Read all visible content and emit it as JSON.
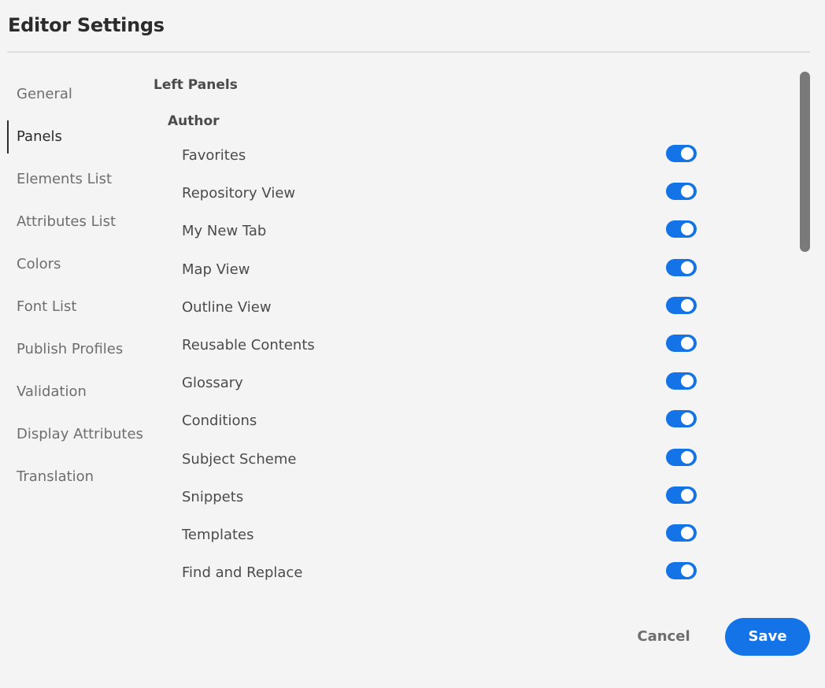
{
  "dialog": {
    "title": "Editor Settings"
  },
  "sidebar": {
    "items": [
      {
        "label": "General",
        "selected": false
      },
      {
        "label": "Panels",
        "selected": true
      },
      {
        "label": "Elements List",
        "selected": false
      },
      {
        "label": "Attributes List",
        "selected": false
      },
      {
        "label": "Colors",
        "selected": false
      },
      {
        "label": "Font List",
        "selected": false
      },
      {
        "label": "Publish Profiles",
        "selected": false
      },
      {
        "label": "Validation",
        "selected": false
      },
      {
        "label": "Display Attributes",
        "selected": false
      },
      {
        "label": "Translation",
        "selected": false
      }
    ]
  },
  "content": {
    "section_heading": "Left Panels",
    "group_heading": "Author",
    "rows": [
      {
        "label": "Favorites",
        "enabled": true
      },
      {
        "label": "Repository View",
        "enabled": true
      },
      {
        "label": "My New Tab",
        "enabled": true
      },
      {
        "label": "Map View",
        "enabled": true
      },
      {
        "label": "Outline View",
        "enabled": true
      },
      {
        "label": "Reusable Contents",
        "enabled": true
      },
      {
        "label": "Glossary",
        "enabled": true
      },
      {
        "label": "Conditions",
        "enabled": true
      },
      {
        "label": "Subject Scheme",
        "enabled": true
      },
      {
        "label": "Snippets",
        "enabled": true
      },
      {
        "label": "Templates",
        "enabled": true
      },
      {
        "label": "Find and Replace",
        "enabled": true
      }
    ]
  },
  "footer": {
    "cancel_label": "Cancel",
    "save_label": "Save"
  },
  "colors": {
    "accent": "#1473e6",
    "background": "#f4f4f4",
    "text_primary": "#2c2c2c",
    "text_secondary": "#6e6e6e"
  }
}
